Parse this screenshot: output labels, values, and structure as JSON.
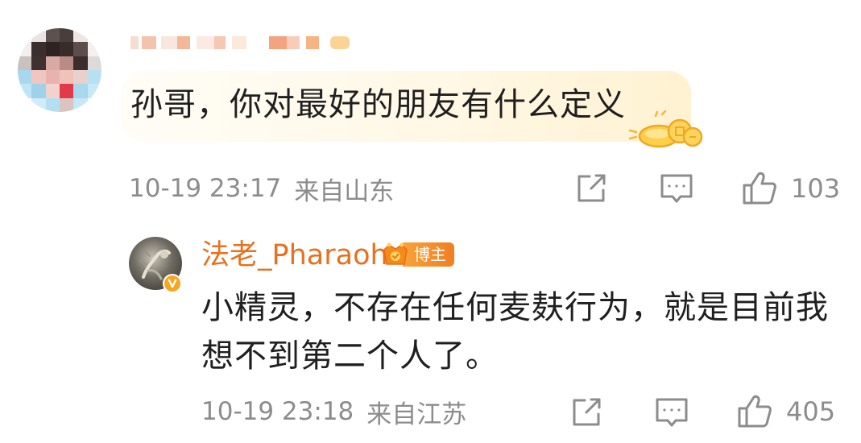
{
  "comment": {
    "text": "孙哥，你对最好的朋友有什么定义",
    "time": "10-19 23:17",
    "location": "来自山东",
    "likes": "103",
    "icons": {
      "share": "share-icon",
      "reply": "comment-icon",
      "like": "thumbs-up-icon"
    }
  },
  "reply": {
    "username": "法老_Pharaoh",
    "badge_label": "博主",
    "text_line1": "小精灵，不存在任何麦麸行为，就是目前我",
    "text_line2": "想不到第二个人了。",
    "time": "10-19 23:18",
    "location": "来自江苏",
    "likes": "405"
  },
  "colors": {
    "text_primary": "#1f1f1f",
    "text_meta": "#8c8c8c",
    "username": "#e8711f",
    "badge": "#f07f22",
    "verified": "#f5a623"
  }
}
